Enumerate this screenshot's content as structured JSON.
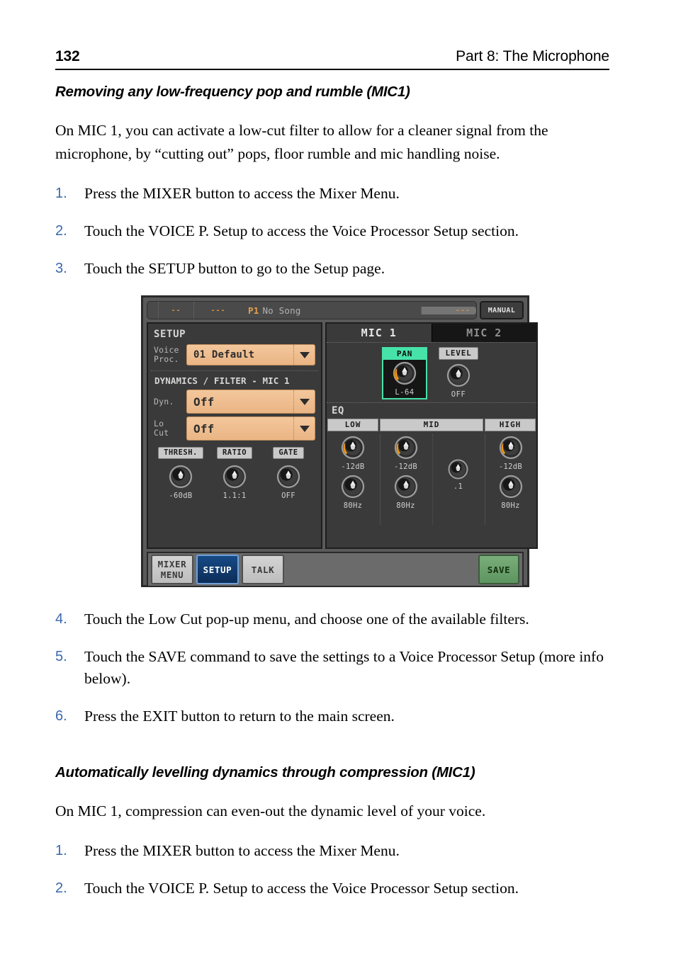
{
  "page": {
    "number": "132",
    "chapter": "Part 8: The Microphone"
  },
  "sections": [
    {
      "heading": "Removing any low-frequency pop and rumble (MIC1)",
      "intro": "On MIC 1, you can activate a low-cut filter to allow for a cleaner signal from the microphone, by “cutting out” pops, floor rumble and mic handling noise.",
      "steps_before": [
        {
          "num": "1.",
          "text": "Press the MIXER button to access the Mixer Menu."
        },
        {
          "num": "2.",
          "text": "Touch the VOICE P. Setup to access the Voice Processor Setup section."
        },
        {
          "num": "3.",
          "text": "Touch the SETUP button to go to the Setup page."
        }
      ],
      "steps_after": [
        {
          "num": "4.",
          "text": "Touch the Low Cut pop-up menu, and choose one of the available filters."
        },
        {
          "num": "5.",
          "text": "Touch the SAVE command to save the settings to a Voice Processor Setup (more info below)."
        },
        {
          "num": "6.",
          "text": "Press the EXIT button to return to the main screen."
        }
      ]
    },
    {
      "heading": "Automatically levelling dynamics through compression (MIC1)",
      "intro": "On MIC 1, compression can even-out the dynamic level of your voice.",
      "steps_before": [
        {
          "num": "1.",
          "text": "Press the MIXER button to access the Mixer Menu."
        },
        {
          "num": "2.",
          "text": "Touch the VOICE P. Setup to access the Voice Processor Setup section."
        }
      ]
    }
  ],
  "device": {
    "topbar": {
      "seg1": "",
      "seg2": "--",
      "seg3": "---",
      "song_number": "P1",
      "song_name": "No Song",
      "right_field": "---",
      "manual_button": "MANUAL"
    },
    "left_panel": {
      "title": "SETUP",
      "voice_proc_label_l1": "Voice",
      "voice_proc_label_l2": "Proc.",
      "voice_proc_value": "01 Default",
      "dynamics_title": "DYNAMICS / FILTER - MIC 1",
      "dyn_label": "Dyn.",
      "dyn_value": "Off",
      "locut_label_l1": "Lo",
      "locut_label_l2": "Cut",
      "locut_value": "Off",
      "knobs": [
        {
          "cap": "THRESH.",
          "value": "-60dB",
          "arc": 0
        },
        {
          "cap": "RATIO",
          "value": "1.1:1",
          "arc": 0
        },
        {
          "cap": "GATE",
          "value": "OFF",
          "arc": 0
        }
      ]
    },
    "right_panel": {
      "tabs": [
        {
          "label": "MIC 1",
          "active": true
        },
        {
          "label": "MIC 2",
          "active": false
        }
      ],
      "pan": {
        "cap": "PAN",
        "value": "L-64",
        "selected": true
      },
      "level": {
        "cap": "LEVEL",
        "value": "OFF",
        "selected": false
      },
      "eq_title": "EQ",
      "eq_headers": [
        "LOW",
        "MID",
        "HIGH"
      ],
      "eq_low": {
        "gain": "-12dB",
        "freq": "80Hz"
      },
      "eq_mid": {
        "gain": "-12dB",
        "freq": "80Hz",
        "q": ".1"
      },
      "eq_high": {
        "gain": "-12dB",
        "freq": "80Hz"
      }
    },
    "buttons": {
      "mixer_menu_l1": "MIXER",
      "mixer_menu_l2": "MENU",
      "setup": "SETUP",
      "talk": "TALK",
      "save": "SAVE"
    },
    "colors": {
      "accent_orange": "#e2a04e",
      "selected_green": "#47e2a8",
      "combo_peach": "#eab584",
      "setup_blue": "#164a86",
      "save_green": "#79ad79"
    }
  }
}
